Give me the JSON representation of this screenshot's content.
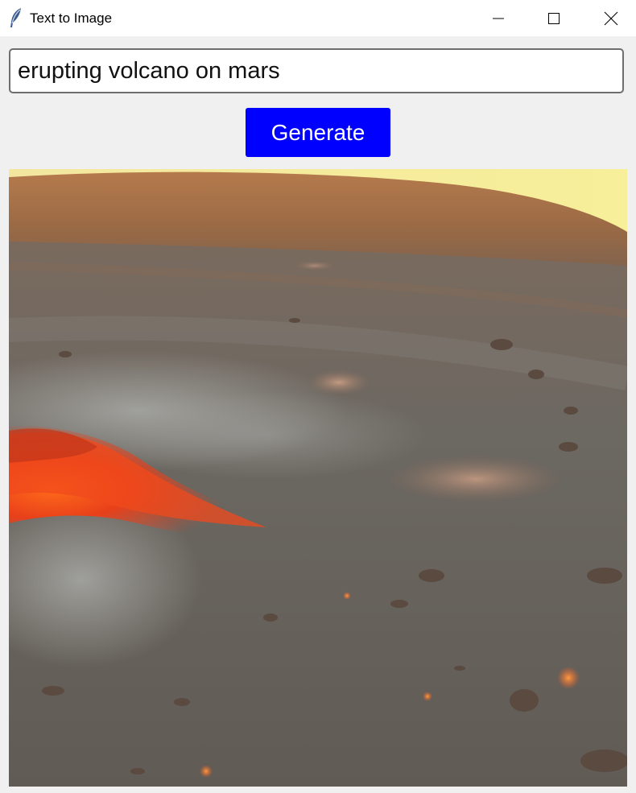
{
  "window": {
    "title": "Text to Image",
    "icon": "feather-icon",
    "controls": [
      "minimize-icon",
      "maximize-icon",
      "close-icon"
    ]
  },
  "prompt": {
    "value": "erupting volcano on mars",
    "placeholder": ""
  },
  "generate": {
    "label": "Generate",
    "color": "#0000ff"
  },
  "result_image": {
    "alt": "erupting volcano on mars"
  }
}
